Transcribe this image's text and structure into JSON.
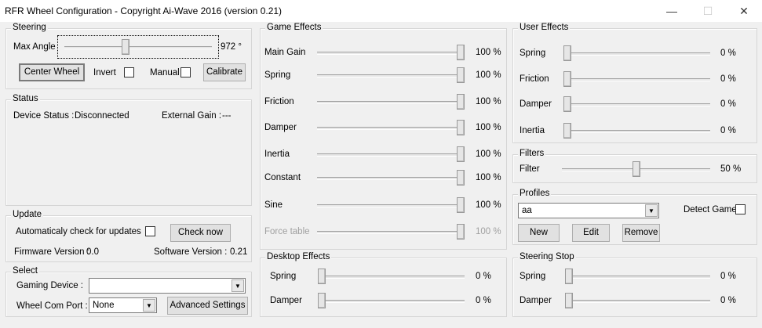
{
  "window": {
    "title": "RFR Wheel Configuration - Copyright Ai-Wave 2016 (version 0.21)",
    "minimize": "—",
    "maximize": "☐",
    "close": "✕"
  },
  "steering": {
    "legend": "Steering",
    "max_angle_label": "Max Angle",
    "max_angle_value": "972 °",
    "slider_fraction": 0.41,
    "center_wheel": "Center Wheel",
    "invert_label": "Invert",
    "manual_label": "Manual",
    "calibrate": "Calibrate"
  },
  "status": {
    "legend": "Status",
    "device_status_label": "Device Status :",
    "device_status_value": "Disconnected",
    "external_gain_label": "External Gain :",
    "external_gain_value": "---"
  },
  "update": {
    "legend": "Update",
    "auto_check_label": "Automaticaly check for updates",
    "check_now": "Check now",
    "firmware_label": "Firmware Version :",
    "firmware_value": "0.0",
    "software_label": "Software Version :",
    "software_value": "0.21"
  },
  "select": {
    "legend": "Select",
    "gaming_device_label": "Gaming Device :",
    "gaming_device_value": "",
    "com_port_label": "Wheel Com Port :",
    "com_port_value": "None",
    "advanced_settings": "Advanced Settings"
  },
  "game_effects": {
    "legend": "Game Effects",
    "items": [
      {
        "label": "Main Gain",
        "value": "100 %",
        "percent": 100
      },
      {
        "label": "Spring",
        "value": "100 %",
        "percent": 100
      },
      {
        "label": "Friction",
        "value": "100 %",
        "percent": 100
      },
      {
        "label": "Damper",
        "value": "100 %",
        "percent": 100
      },
      {
        "label": "Inertia",
        "value": "100 %",
        "percent": 100
      },
      {
        "label": "Constant",
        "value": "100 %",
        "percent": 100
      },
      {
        "label": "Sine",
        "value": "100 %",
        "percent": 100
      },
      {
        "label": "Force table",
        "value": "100 %",
        "percent": 100,
        "disabled": true
      }
    ]
  },
  "desktop_effects": {
    "legend": "Desktop Effects",
    "items": [
      {
        "label": "Spring",
        "value": "0 %",
        "percent": 0
      },
      {
        "label": "Damper",
        "value": "0 %",
        "percent": 0
      }
    ]
  },
  "user_effects": {
    "legend": "User Effects",
    "items": [
      {
        "label": "Spring",
        "value": "0 %",
        "percent": 0
      },
      {
        "label": "Friction",
        "value": "0 %",
        "percent": 0
      },
      {
        "label": "Damper",
        "value": "0 %",
        "percent": 0
      },
      {
        "label": "Inertia",
        "value": "0 %",
        "percent": 0
      }
    ]
  },
  "filters": {
    "legend": "Filters",
    "items": [
      {
        "label": "Filter",
        "value": "50 %",
        "percent": 50
      }
    ]
  },
  "profiles": {
    "legend": "Profiles",
    "selected": "aa",
    "detect_game_label": "Detect Game",
    "new": "New",
    "edit": "Edit",
    "remove": "Remove"
  },
  "steering_stop": {
    "legend": "Steering Stop",
    "items": [
      {
        "label": "Spring",
        "value": "0 %",
        "percent": 0
      },
      {
        "label": "Damper",
        "value": "0 %",
        "percent": 0
      }
    ]
  }
}
